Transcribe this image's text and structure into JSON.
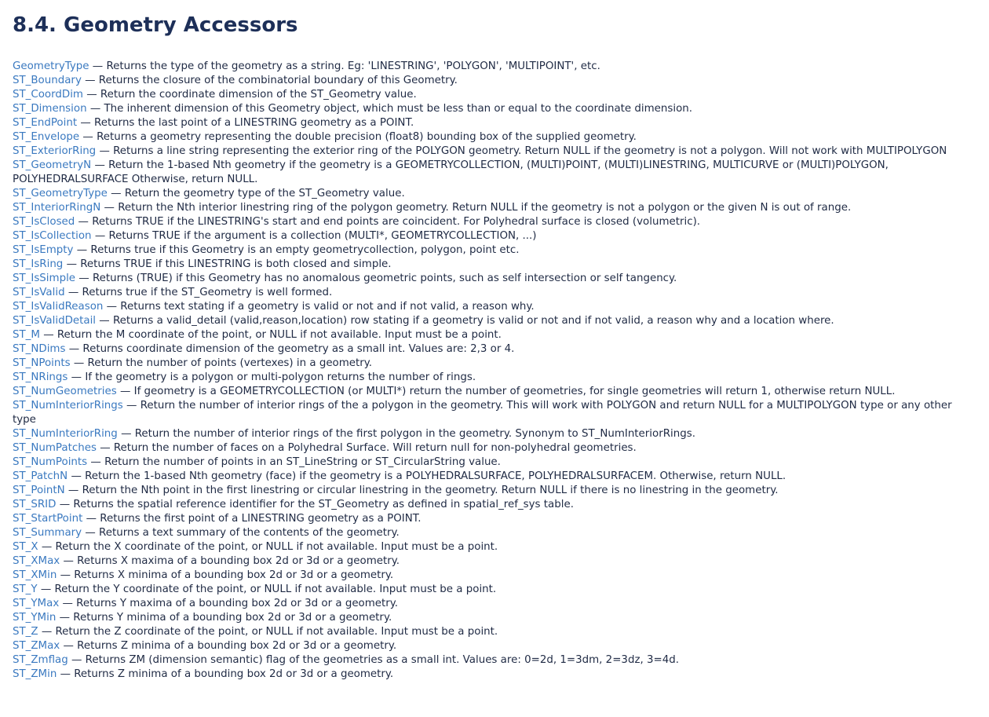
{
  "page": {
    "title": "8.4. Geometry Accessors"
  },
  "separator": "—",
  "entries": [
    {
      "name": "GeometryType",
      "desc": "Returns the type of the geometry as a string. Eg: 'LINESTRING', 'POLYGON', 'MULTIPOINT', etc."
    },
    {
      "name": "ST_Boundary",
      "desc": "Returns the closure of the combinatorial boundary of this Geometry."
    },
    {
      "name": "ST_CoordDim",
      "desc": "Return the coordinate dimension of the ST_Geometry value."
    },
    {
      "name": "ST_Dimension",
      "desc": "The inherent dimension of this Geometry object, which must be less than or equal to the coordinate dimension."
    },
    {
      "name": "ST_EndPoint",
      "desc": "Returns the last point of a LINESTRING geometry as a POINT."
    },
    {
      "name": "ST_Envelope",
      "desc": "Returns a geometry representing the double precision (float8) bounding box of the supplied geometry."
    },
    {
      "name": "ST_ExteriorRing",
      "desc": "Returns a line string representing the exterior ring of the POLYGON geometry. Return NULL if the geometry is not a polygon. Will not work with MULTIPOLYGON"
    },
    {
      "name": "ST_GeometryN",
      "desc": "Return the 1-based Nth geometry if the geometry is a GEOMETRYCOLLECTION, (MULTI)POINT, (MULTI)LINESTRING, MULTICURVE or (MULTI)POLYGON, POLYHEDRALSURFACE Otherwise, return NULL."
    },
    {
      "name": "ST_GeometryType",
      "desc": "Return the geometry type of the ST_Geometry value."
    },
    {
      "name": "ST_InteriorRingN",
      "desc": "Return the Nth interior linestring ring of the polygon geometry. Return NULL if the geometry is not a polygon or the given N is out of range."
    },
    {
      "name": "ST_IsClosed",
      "desc": "Returns TRUE if the LINESTRING's start and end points are coincident. For Polyhedral surface is closed (volumetric)."
    },
    {
      "name": "ST_IsCollection",
      "desc": "Returns TRUE if the argument is a collection (MULTI*, GEOMETRYCOLLECTION, ...)"
    },
    {
      "name": "ST_IsEmpty",
      "desc": "Returns true if this Geometry is an empty geometrycollection, polygon, point etc."
    },
    {
      "name": "ST_IsRing",
      "desc": "Returns TRUE if this LINESTRING is both closed and simple."
    },
    {
      "name": "ST_IsSimple",
      "desc": "Returns (TRUE) if this Geometry has no anomalous geometric points, such as self intersection or self tangency."
    },
    {
      "name": "ST_IsValid",
      "desc": "Returns true if the ST_Geometry is well formed."
    },
    {
      "name": "ST_IsValidReason",
      "desc": "Returns text stating if a geometry is valid or not and if not valid, a reason why."
    },
    {
      "name": "ST_IsValidDetail",
      "desc": "Returns a valid_detail (valid,reason,location) row stating if a geometry is valid or not and if not valid, a reason why and a location where."
    },
    {
      "name": "ST_M",
      "desc": "Return the M coordinate of the point, or NULL if not available. Input must be a point."
    },
    {
      "name": "ST_NDims",
      "desc": "Returns coordinate dimension of the geometry as a small int. Values are: 2,3 or 4."
    },
    {
      "name": "ST_NPoints",
      "desc": "Return the number of points (vertexes) in a geometry."
    },
    {
      "name": "ST_NRings",
      "desc": "If the geometry is a polygon or multi-polygon returns the number of rings."
    },
    {
      "name": "ST_NumGeometries",
      "desc": "If geometry is a GEOMETRYCOLLECTION (or MULTI*) return the number of geometries, for single geometries will return 1, otherwise return NULL."
    },
    {
      "name": "ST_NumInteriorRings",
      "desc": "Return the number of interior rings of the a polygon in the geometry. This will work with POLYGON and return NULL for a MULTIPOLYGON type or any other type"
    },
    {
      "name": "ST_NumInteriorRing",
      "desc": "Return the number of interior rings of the first polygon in the geometry. Synonym to ST_NumInteriorRings."
    },
    {
      "name": "ST_NumPatches",
      "desc": "Return the number of faces on a Polyhedral Surface. Will return null for non-polyhedral geometries."
    },
    {
      "name": "ST_NumPoints",
      "desc": "Return the number of points in an ST_LineString or ST_CircularString value."
    },
    {
      "name": "ST_PatchN",
      "desc": "Return the 1-based Nth geometry (face) if the geometry is a POLYHEDRALSURFACE, POLYHEDRALSURFACEM. Otherwise, return NULL."
    },
    {
      "name": "ST_PointN",
      "desc": "Return the Nth point in the first linestring or circular linestring in the geometry. Return NULL if there is no linestring in the geometry."
    },
    {
      "name": "ST_SRID",
      "desc": "Returns the spatial reference identifier for the ST_Geometry as defined in spatial_ref_sys table."
    },
    {
      "name": "ST_StartPoint",
      "desc": "Returns the first point of a LINESTRING geometry as a POINT."
    },
    {
      "name": "ST_Summary",
      "desc": "Returns a text summary of the contents of the geometry."
    },
    {
      "name": "ST_X",
      "desc": "Return the X coordinate of the point, or NULL if not available. Input must be a point."
    },
    {
      "name": "ST_XMax",
      "desc": "Returns X maxima of a bounding box 2d or 3d or a geometry."
    },
    {
      "name": "ST_XMin",
      "desc": "Returns X minima of a bounding box 2d or 3d or a geometry."
    },
    {
      "name": "ST_Y",
      "desc": "Return the Y coordinate of the point, or NULL if not available. Input must be a point."
    },
    {
      "name": "ST_YMax",
      "desc": "Returns Y maxima of a bounding box 2d or 3d or a geometry."
    },
    {
      "name": "ST_YMin",
      "desc": "Returns Y minima of a bounding box 2d or 3d or a geometry."
    },
    {
      "name": "ST_Z",
      "desc": "Return the Z coordinate of the point, or NULL if not available. Input must be a point."
    },
    {
      "name": "ST_ZMax",
      "desc": "Returns Z minima of a bounding box 2d or 3d or a geometry."
    },
    {
      "name": "ST_Zmflag",
      "desc": "Returns ZM (dimension semantic) flag of the geometries as a small int. Values are: 0=2d, 1=3dm, 2=3dz, 3=4d."
    },
    {
      "name": "ST_ZMin",
      "desc": "Returns Z minima of a bounding box 2d or 3d or a geometry."
    }
  ]
}
